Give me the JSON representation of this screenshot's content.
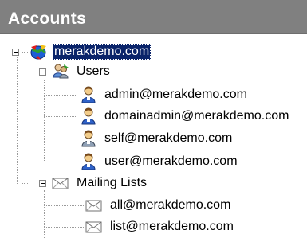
{
  "header": {
    "title": "Accounts"
  },
  "tree": {
    "root": {
      "label": "merakdemo.com",
      "icon": "domain-globe-icon",
      "selected": true
    },
    "users_group": {
      "label": "Users",
      "icon": "users-group-icon"
    },
    "users": [
      {
        "label": "admin@merakdemo.com",
        "icon": "user-icon"
      },
      {
        "label": "domainadmin@merakdemo.com",
        "icon": "user-icon"
      },
      {
        "label": "self@merakdemo.com",
        "icon": "user-icon"
      },
      {
        "label": "user@merakdemo.com",
        "icon": "user-icon"
      }
    ],
    "lists_group": {
      "label": "Mailing Lists",
      "icon": "mailing-lists-icon"
    },
    "lists": [
      {
        "label": "all@merakdemo.com",
        "icon": "envelope-icon"
      },
      {
        "label": "list@merakdemo.com",
        "icon": "envelope-icon"
      }
    ]
  },
  "colors": {
    "header_bg": "#808080",
    "selection_bg": "#0a246a"
  }
}
